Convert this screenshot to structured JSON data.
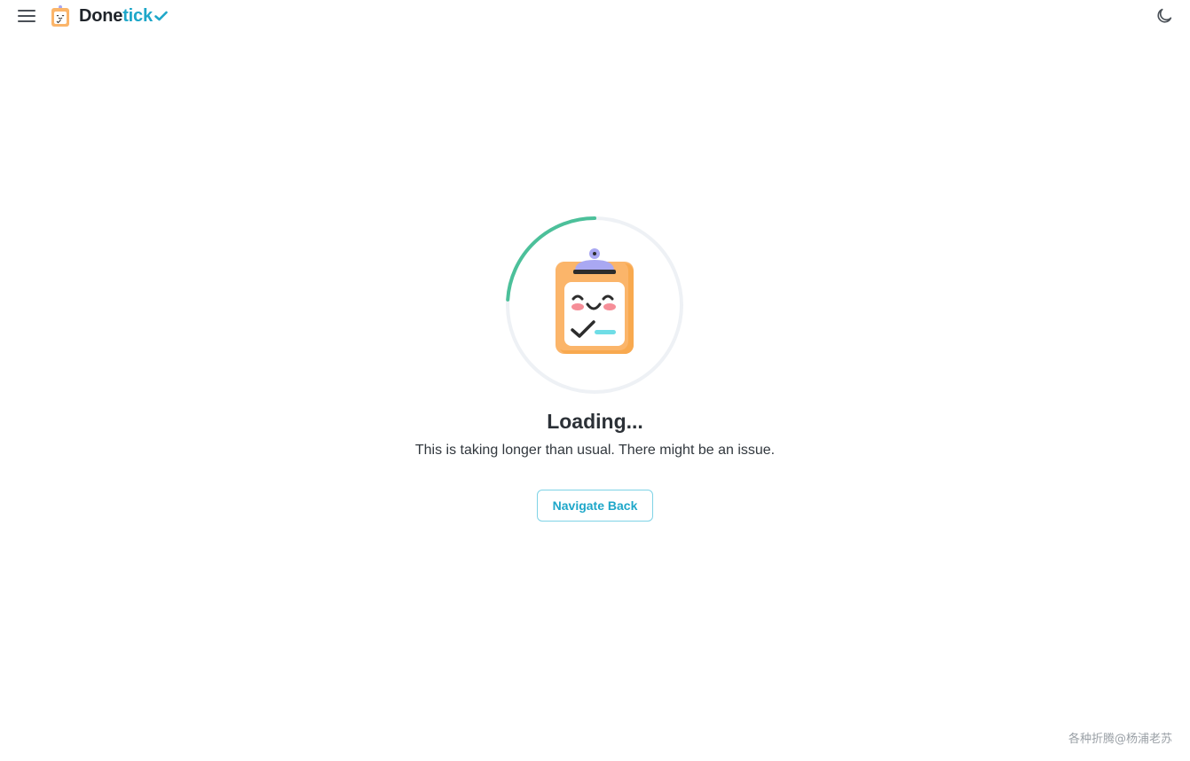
{
  "header": {
    "brand_primary": "Done",
    "brand_accent": "tick",
    "menu_icon": "hamburger-menu-icon",
    "theme_icon": "moon-icon"
  },
  "loading": {
    "title": "Loading...",
    "message": "This is taking longer than usual. There might be an issue.",
    "progress_fraction": 0.24
  },
  "actions": {
    "back_label": "Navigate Back"
  },
  "watermark": "各种折腾@杨浦老苏",
  "colors": {
    "accent": "#1ea7c9",
    "spinner": "#4cc09a",
    "spinner_track": "#eef1f5",
    "clipboard": "#fbb56a",
    "clip": "#a9a8f2"
  }
}
